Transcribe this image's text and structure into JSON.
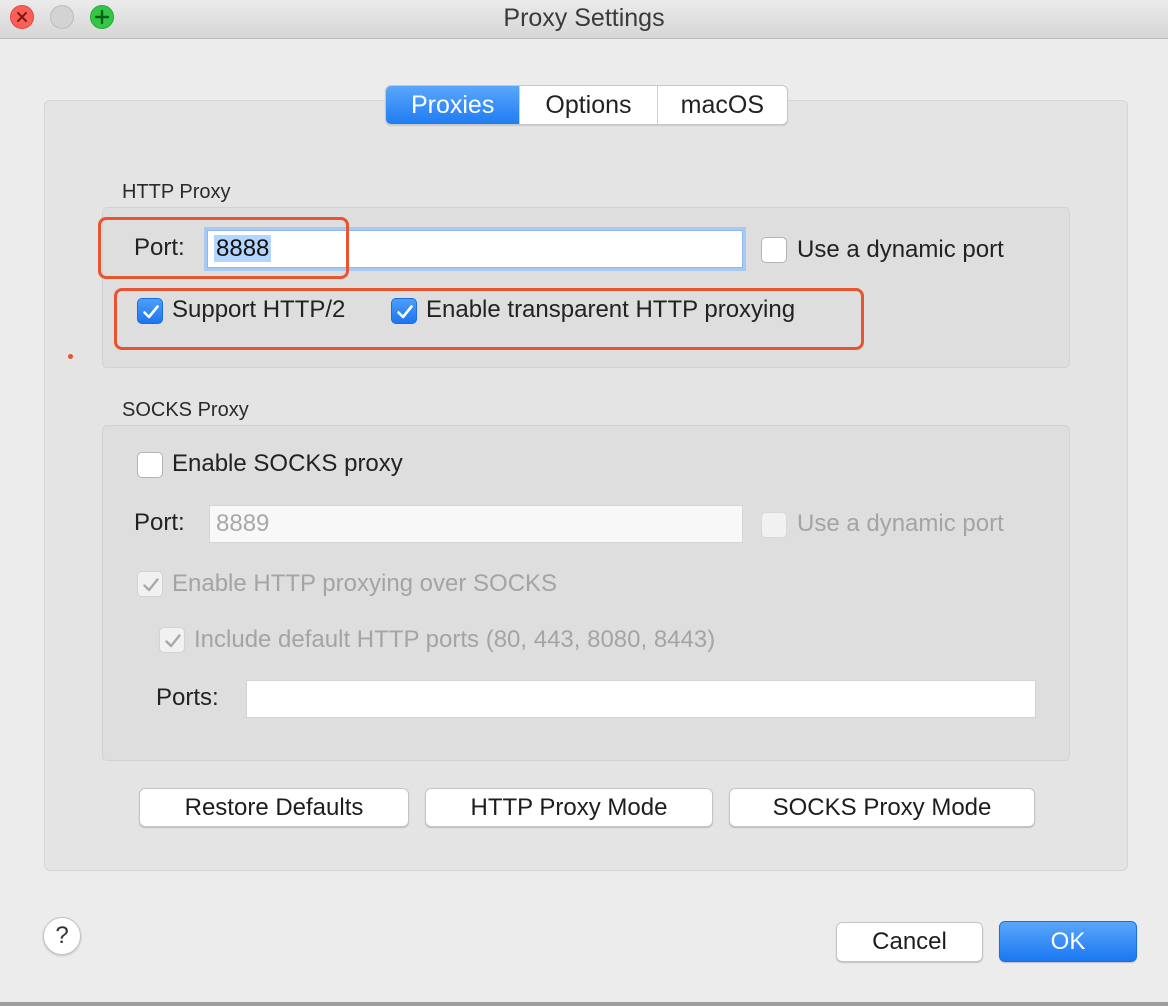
{
  "window": {
    "title": "Proxy Settings"
  },
  "tabs": [
    {
      "label": "Proxies",
      "active": true
    },
    {
      "label": "Options",
      "active": false
    },
    {
      "label": "macOS",
      "active": false
    }
  ],
  "http_proxy": {
    "section_label": "HTTP Proxy",
    "port_label": "Port:",
    "port_value": "8888",
    "dynamic_port_label": "Use a dynamic port",
    "dynamic_port_checked": false,
    "http2_label": "Support HTTP/2",
    "http2_checked": true,
    "transparent_label": "Enable transparent HTTP proxying",
    "transparent_checked": true
  },
  "socks_proxy": {
    "section_label": "SOCKS Proxy",
    "enable_label": "Enable SOCKS proxy",
    "enable_checked": false,
    "port_label": "Port:",
    "port_placeholder": "8889",
    "dynamic_port_label": "Use a dynamic port",
    "http_over_socks_label": "Enable HTTP proxying over SOCKS",
    "http_over_socks_checked": true,
    "default_ports_label": "Include default HTTP ports (80, 443, 8080, 8443)",
    "default_ports_checked": true,
    "ports_label": "Ports:",
    "ports_value": ""
  },
  "buttons": {
    "restore_defaults": "Restore Defaults",
    "http_proxy_mode": "HTTP Proxy Mode",
    "socks_proxy_mode": "SOCKS Proxy Mode",
    "help": "?",
    "cancel": "Cancel",
    "ok": "OK"
  },
  "colors": {
    "accent": "#1f7cf2",
    "annotation": "#e8542f"
  }
}
